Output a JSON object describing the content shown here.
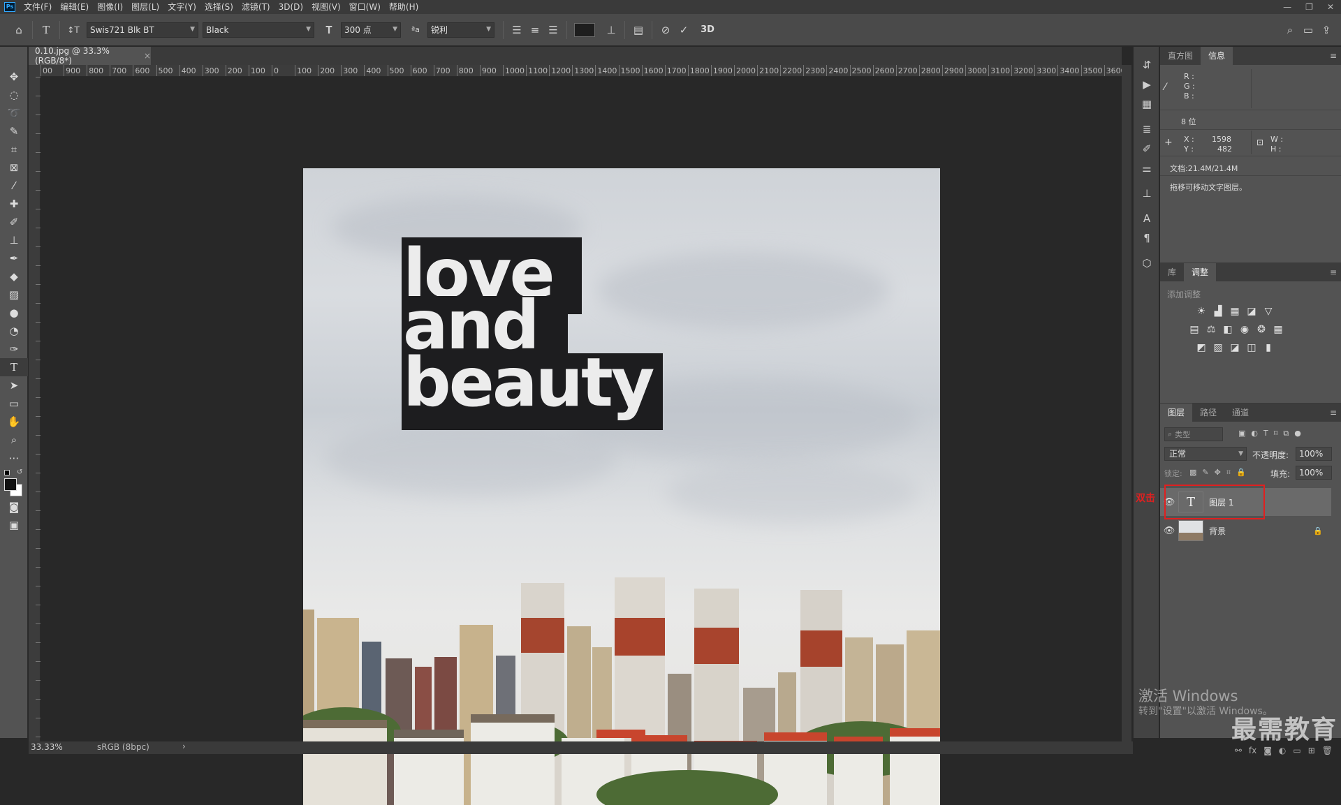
{
  "app": {
    "logo": "Ps"
  },
  "menu": [
    "文件(F)",
    "编辑(E)",
    "图像(I)",
    "图层(L)",
    "文字(Y)",
    "选择(S)",
    "滤镜(T)",
    "3D(D)",
    "视图(V)",
    "窗口(W)",
    "帮助(H)"
  ],
  "window_controls": [
    "—",
    "❐",
    "✕"
  ],
  "options": {
    "font_family": "Swis721 Blk BT",
    "font_style": "Black",
    "font_size": "300 点",
    "aa_label": "ªa",
    "antialias": "锐利",
    "label_3d": "3D",
    "text_color": "#1e1e1e"
  },
  "document": {
    "tab_title": "0.10.jpg @ 33.3%(RGB/8*)",
    "close_glyph": "×",
    "text_lines": [
      "love",
      "and",
      "beauty"
    ]
  },
  "ruler": {
    "h_labels": [
      "00",
      "900",
      "800",
      "700",
      "600",
      "500",
      "400",
      "300",
      "200",
      "100",
      "0",
      "100",
      "200",
      "300",
      "400",
      "500",
      "600",
      "700",
      "800",
      "900",
      "1000",
      "1100",
      "1200",
      "1300",
      "1400",
      "1500",
      "1600",
      "1700",
      "1800",
      "1900",
      "2000",
      "2100",
      "2200",
      "2300",
      "2400",
      "2500",
      "2600",
      "2700",
      "2800",
      "2900",
      "3000",
      "3100",
      "3200",
      "3300",
      "3400",
      "3500",
      "3600"
    ]
  },
  "info_panel": {
    "tabs": [
      "直方图",
      "信息"
    ],
    "r_label": "R :",
    "g_label": "G :",
    "b_label": "B :",
    "bit_depth": "8 位",
    "x_label": "X :",
    "x_value": "1598",
    "y_label": "Y :",
    "y_value": "482",
    "w_label": "W :",
    "h_label": "H :",
    "doc_size": "文档:21.4M/21.4M",
    "hint": "拖移可移动文字图层。"
  },
  "adjust_panel": {
    "tabs": [
      "库",
      "调整"
    ],
    "add_adjustment": "添加调整"
  },
  "layers_panel": {
    "tabs": [
      "图层",
      "路径",
      "通道"
    ],
    "filter_placeholder": "类型",
    "blend_mode": "正常",
    "opacity_label": "不透明度:",
    "opacity_value": "100%",
    "lock_label": "锁定:",
    "fill_label": "填充:",
    "fill_value": "100%",
    "layers": [
      {
        "name": "图层 1",
        "type": "text",
        "selected": true
      },
      {
        "name": "背景",
        "type": "image",
        "locked": true
      }
    ],
    "annotation": "双击",
    "annotation_color": "#e02020"
  },
  "status": {
    "zoom": "33.33%",
    "profile": "sRGB (8bpc)",
    "arrow": "›"
  },
  "watermark": {
    "line1": "激活 Windows",
    "line2": "转到\"设置\"以激活 Windows。",
    "brand": "最需教育"
  }
}
